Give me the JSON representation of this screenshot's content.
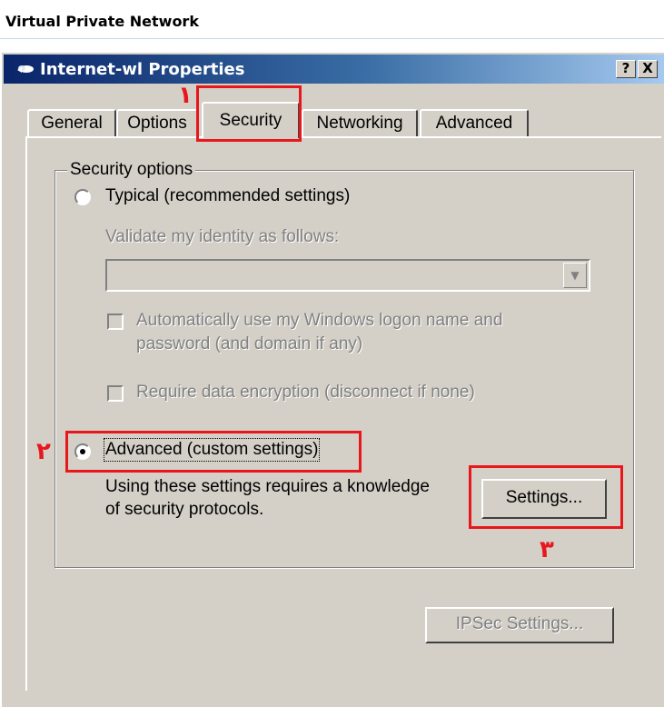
{
  "page": {
    "heading": "Virtual Private Network"
  },
  "dialog": {
    "title": "Internet-wl Properties",
    "help_button": "?",
    "close_button": "X"
  },
  "tabs": [
    {
      "label": "General",
      "active": false
    },
    {
      "label": "Options",
      "active": false
    },
    {
      "label": "Security",
      "active": true
    },
    {
      "label": "Networking",
      "active": false
    },
    {
      "label": "Advanced",
      "active": false
    }
  ],
  "security": {
    "group_label": "Security options",
    "typical_label": "Typical (recommended settings)",
    "typical_selected": false,
    "validate_label": "Validate my identity as follows:",
    "validate_value": "",
    "auto_logon_label_line1": "Automatically use my Windows logon name and",
    "auto_logon_label_line2": "password (and domain if any)",
    "auto_logon_checked": false,
    "encryption_label": "Require data encryption (disconnect if none)",
    "encryption_checked": false,
    "advanced_label": "Advanced (custom settings)",
    "advanced_selected": true,
    "advanced_note_line1": "Using these settings requires a knowledge",
    "advanced_note_line2": "of security protocols.",
    "settings_button": "Settings...",
    "ipsec_button": "IPSec Settings..."
  },
  "annotations": {
    "color": "#e8171c",
    "step1": "١",
    "step2": "٢",
    "step3": "٣"
  },
  "colors": {
    "dialog_face": "#d4d0c8",
    "titlebar_start": "#0a246a",
    "titlebar_end": "#a6caf0"
  }
}
